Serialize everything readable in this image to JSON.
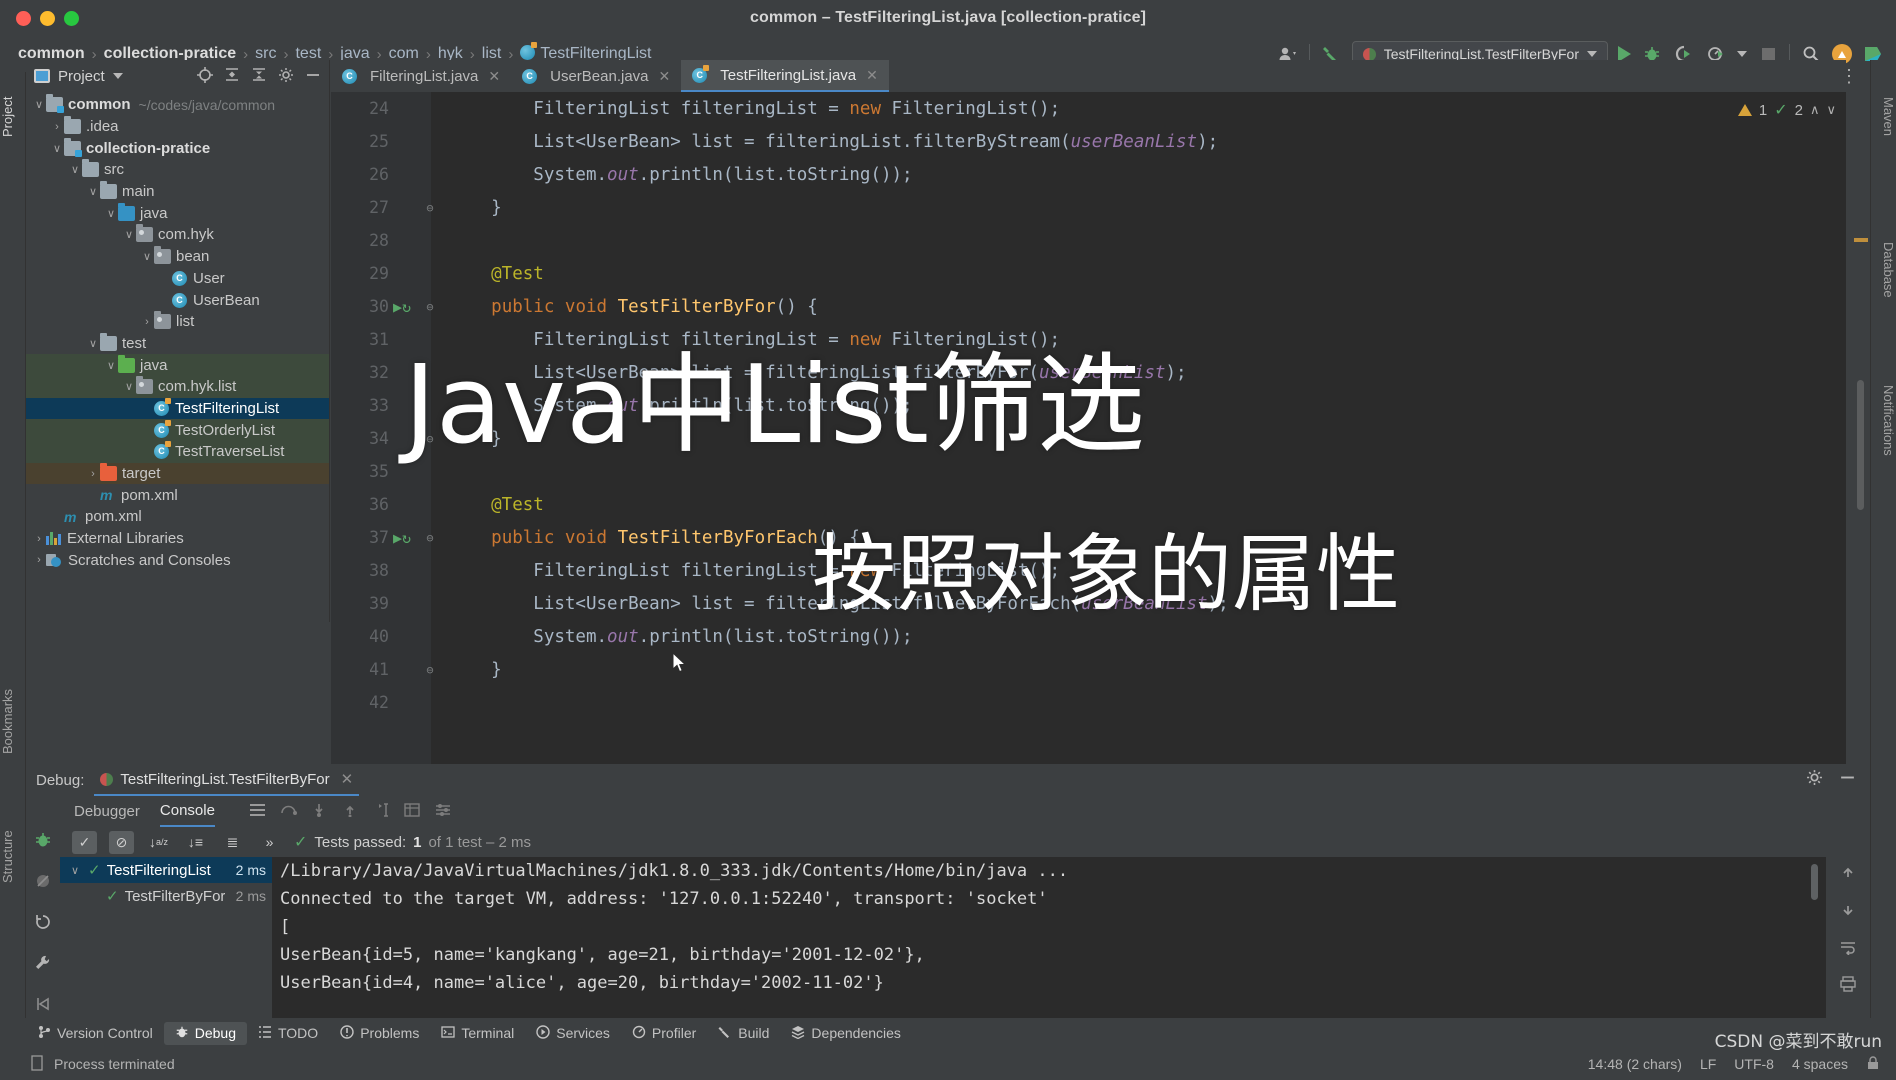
{
  "window": {
    "title": "common – TestFilteringList.java [collection-pratice]",
    "buttons": {
      "close": "close",
      "minimize": "minimize",
      "maximize": "maximize"
    }
  },
  "breadcrumb": {
    "items": [
      {
        "label": "common",
        "bold": true
      },
      {
        "label": "collection-pratice",
        "bold": true
      },
      {
        "label": "src",
        "bold": false
      },
      {
        "label": "test",
        "bold": false
      },
      {
        "label": "java",
        "bold": false
      },
      {
        "label": "com",
        "bold": false
      },
      {
        "label": "hyk",
        "bold": false
      },
      {
        "label": "list",
        "bold": false
      },
      {
        "label": "TestFilteringList",
        "bold": false,
        "icon": "java-test-class-icon"
      }
    ],
    "separator": "›"
  },
  "toolbar": {
    "run_config": "TestFilteringList.TestFilterByFor",
    "icons": [
      "user-icon",
      "hammer-build-icon",
      "run-icon",
      "debug-icon",
      "run-with-coverage-icon",
      "profiler-icon",
      "stop-icon",
      "search-icon",
      "update-icon",
      "ide-logo-icon"
    ]
  },
  "left_strip": {
    "tabs": [
      "Project",
      "Bookmarks",
      "Structure"
    ]
  },
  "right_strip": {
    "tabs": [
      "Maven",
      "Database",
      "Notifications"
    ]
  },
  "project_panel": {
    "title": "Project",
    "header_icons": [
      "locate-icon",
      "expand-all-icon",
      "collapse-all-icon",
      "settings-icon",
      "hide-icon"
    ],
    "tree": [
      {
        "depth": 0,
        "arrow": "v",
        "icon": "module-folder",
        "label": "common",
        "bold": true,
        "path": "~/codes/java/common",
        "state": ""
      },
      {
        "depth": 1,
        "arrow": ">",
        "icon": "folder",
        "label": ".idea",
        "bold": false,
        "path": "",
        "state": ""
      },
      {
        "depth": 1,
        "arrow": "v",
        "icon": "module-folder",
        "label": "collection-pratice",
        "bold": true,
        "path": "",
        "state": ""
      },
      {
        "depth": 2,
        "arrow": "v",
        "icon": "folder",
        "label": "src",
        "bold": false,
        "path": "",
        "state": ""
      },
      {
        "depth": 3,
        "arrow": "v",
        "icon": "folder",
        "label": "main",
        "bold": false,
        "path": "",
        "state": ""
      },
      {
        "depth": 4,
        "arrow": "v",
        "icon": "source-folder-blue",
        "label": "java",
        "bold": false,
        "path": "",
        "state": ""
      },
      {
        "depth": 5,
        "arrow": "v",
        "icon": "package",
        "label": "com.hyk",
        "bold": false,
        "path": "",
        "state": ""
      },
      {
        "depth": 6,
        "arrow": "v",
        "icon": "package",
        "label": "bean",
        "bold": false,
        "path": "",
        "state": ""
      },
      {
        "depth": 7,
        "arrow": "",
        "icon": "class",
        "label": "User",
        "bold": false,
        "path": "",
        "state": ""
      },
      {
        "depth": 7,
        "arrow": "",
        "icon": "class",
        "label": "UserBean",
        "bold": false,
        "path": "",
        "state": ""
      },
      {
        "depth": 6,
        "arrow": ">",
        "icon": "package",
        "label": "list",
        "bold": false,
        "path": "",
        "state": ""
      },
      {
        "depth": 3,
        "arrow": "v",
        "icon": "folder",
        "label": "test",
        "bold": false,
        "path": "",
        "state": ""
      },
      {
        "depth": 4,
        "arrow": "v",
        "icon": "test-source-folder-green",
        "label": "java",
        "bold": false,
        "path": "",
        "state": "green"
      },
      {
        "depth": 5,
        "arrow": "v",
        "icon": "package",
        "label": "com.hyk.list",
        "bold": false,
        "path": "",
        "state": "green"
      },
      {
        "depth": 6,
        "arrow": "",
        "icon": "test-class",
        "label": "TestFilteringList",
        "bold": false,
        "path": "",
        "state": "selected"
      },
      {
        "depth": 6,
        "arrow": "",
        "icon": "test-class",
        "label": "TestOrderlyList",
        "bold": false,
        "path": "",
        "state": "green"
      },
      {
        "depth": 6,
        "arrow": "",
        "icon": "test-class",
        "label": "TestTraverseList",
        "bold": false,
        "path": "",
        "state": "green"
      },
      {
        "depth": 3,
        "arrow": ">",
        "icon": "folder-excluded-red",
        "label": "target",
        "bold": false,
        "path": "",
        "state": "brown"
      },
      {
        "depth": 3,
        "arrow": "",
        "icon": "maven",
        "label": "pom.xml",
        "bold": false,
        "path": "",
        "state": ""
      },
      {
        "depth": 1,
        "arrow": "",
        "icon": "maven",
        "label": "pom.xml",
        "bold": false,
        "path": "",
        "state": ""
      },
      {
        "depth": 0,
        "arrow": ">",
        "icon": "external-libraries",
        "label": "External Libraries",
        "bold": false,
        "path": "",
        "state": ""
      },
      {
        "depth": 0,
        "arrow": ">",
        "icon": "scratches",
        "label": "Scratches and Consoles",
        "bold": false,
        "path": "",
        "state": ""
      }
    ]
  },
  "editor_tabs": [
    {
      "label": "FilteringList.java",
      "icon": "class-icon",
      "active": false
    },
    {
      "label": "UserBean.java",
      "icon": "class-icon",
      "active": false
    },
    {
      "label": "TestFilteringList.java",
      "icon": "test-class-icon",
      "active": true
    }
  ],
  "inspection": {
    "warnings": "1",
    "checks": "2"
  },
  "editor": {
    "lines": [
      {
        "num": "24",
        "run": false,
        "fold": "",
        "tokens": [
          {
            "t": "        FilteringList filteringList = ",
            "c": "def"
          },
          {
            "t": "new",
            "c": "kw"
          },
          {
            "t": " FilteringList()",
            "c": "def"
          },
          {
            "t": ";",
            "c": "def"
          }
        ]
      },
      {
        "num": "25",
        "run": false,
        "fold": "",
        "tokens": [
          {
            "t": "        List<UserBean> list = filteringList.filterByStream(",
            "c": "def"
          },
          {
            "t": "userBeanList",
            "c": "prm"
          },
          {
            "t": ");",
            "c": "def"
          }
        ]
      },
      {
        "num": "26",
        "run": false,
        "fold": "",
        "tokens": [
          {
            "t": "        System.",
            "c": "def"
          },
          {
            "t": "out",
            "c": "fld"
          },
          {
            "t": ".println(list.toString());",
            "c": "def"
          }
        ]
      },
      {
        "num": "27",
        "run": false,
        "fold": "end",
        "tokens": [
          {
            "t": "    }",
            "c": "def"
          }
        ]
      },
      {
        "num": "28",
        "run": false,
        "fold": "",
        "tokens": []
      },
      {
        "num": "29",
        "run": false,
        "fold": "",
        "tokens": [
          {
            "t": "    @Test",
            "c": "ann"
          }
        ]
      },
      {
        "num": "30",
        "run": true,
        "fold": "start",
        "tokens": [
          {
            "t": "    ",
            "c": "def"
          },
          {
            "t": "public void",
            "c": "kw"
          },
          {
            "t": " ",
            "c": "def"
          },
          {
            "t": "TestFilterByFor",
            "c": "mtd"
          },
          {
            "t": "() {",
            "c": "def"
          }
        ]
      },
      {
        "num": "31",
        "run": false,
        "fold": "",
        "tokens": [
          {
            "t": "        FilteringList filteringList = ",
            "c": "def"
          },
          {
            "t": "new",
            "c": "kw"
          },
          {
            "t": " FilteringList();",
            "c": "def"
          }
        ]
      },
      {
        "num": "32",
        "run": false,
        "fold": "",
        "tokens": [
          {
            "t": "        List<UserBean> list = filteringList.filterByFor(",
            "c": "def"
          },
          {
            "t": "userBeanList",
            "c": "prm"
          },
          {
            "t": ");",
            "c": "def"
          }
        ]
      },
      {
        "num": "33",
        "run": false,
        "fold": "",
        "tokens": [
          {
            "t": "        System.",
            "c": "def"
          },
          {
            "t": "out",
            "c": "fld"
          },
          {
            "t": ".println(list.toString());",
            "c": "def"
          }
        ]
      },
      {
        "num": "34",
        "run": false,
        "fold": "end",
        "tokens": [
          {
            "t": "    }",
            "c": "def"
          }
        ]
      },
      {
        "num": "35",
        "run": false,
        "fold": "",
        "tokens": []
      },
      {
        "num": "36",
        "run": false,
        "fold": "",
        "tokens": [
          {
            "t": "    @Test",
            "c": "ann"
          }
        ]
      },
      {
        "num": "37",
        "run": true,
        "fold": "start",
        "tokens": [
          {
            "t": "    ",
            "c": "def"
          },
          {
            "t": "public void",
            "c": "kw"
          },
          {
            "t": " ",
            "c": "def"
          },
          {
            "t": "TestFilterByForEach",
            "c": "mtd"
          },
          {
            "t": "() {",
            "c": "def"
          }
        ]
      },
      {
        "num": "38",
        "run": false,
        "fold": "",
        "tokens": [
          {
            "t": "        FilteringList filteringList = ",
            "c": "def"
          },
          {
            "t": "new",
            "c": "kw"
          },
          {
            "t": " FilteringList();",
            "c": "def"
          }
        ]
      },
      {
        "num": "39",
        "run": false,
        "fold": "",
        "tokens": [
          {
            "t": "        List<UserBean> list = filteringList.filterByForEach(",
            "c": "def"
          },
          {
            "t": "userBeanList",
            "c": "prm"
          },
          {
            "t": ");",
            "c": "def"
          }
        ]
      },
      {
        "num": "40",
        "run": false,
        "fold": "",
        "tokens": [
          {
            "t": "        System.",
            "c": "def"
          },
          {
            "t": "out",
            "c": "fld"
          },
          {
            "t": ".println(list.toString());",
            "c": "def"
          }
        ]
      },
      {
        "num": "41",
        "run": false,
        "fold": "end",
        "tokens": [
          {
            "t": "    }",
            "c": "def"
          }
        ]
      },
      {
        "num": "42",
        "run": false,
        "fold": "",
        "tokens": []
      }
    ]
  },
  "overlay": {
    "title_main": "Java中List筛选",
    "title_sub": "按照对象的属性"
  },
  "debug": {
    "label": "Debug:",
    "session_tab": "TestFilteringList.TestFilterByFor",
    "tabs": [
      "Debugger",
      "Console"
    ],
    "active_tab": "Console",
    "tool_icons": [
      "frames-icon",
      "step-over-icon",
      "step-into-icon",
      "step-out-icon",
      "run-to-cursor-icon",
      "table-icon",
      "settings-icon"
    ],
    "test_toolbar": {
      "buttons": [
        "show-passed-icon",
        "hide-ignored-icon",
        "sort-alpha-icon",
        "sort-duration-icon",
        "expand-icon",
        "more-icon"
      ],
      "status": {
        "prefix": "Tests passed:",
        "count": "1",
        "suffix": "of 1 test – 2 ms"
      }
    },
    "test_tree": [
      {
        "label": "TestFilteringList",
        "time": "2 ms",
        "selected": true,
        "arrow": "v",
        "depth": 0
      },
      {
        "label": "TestFilterByFor",
        "time": "2 ms",
        "selected": false,
        "arrow": "",
        "depth": 1
      }
    ],
    "console_lines": [
      {
        "text": "/Library/Java/JavaVirtualMachines/jdk1.8.0_333.jdk/Contents/Home/bin/java ...",
        "kind": "cmd"
      },
      {
        "text": "Connected to the target VM, address: '127.0.0.1:52240', transport: 'socket'",
        "kind": "out"
      },
      {
        "text": "[",
        "kind": "out"
      },
      {
        "text": "UserBean{id=5, name='kangkang', age=21, birthday='2001-12-02'},",
        "kind": "out"
      },
      {
        "text": "UserBean{id=4, name='alice', age=20, birthday='2002-11-02'}",
        "kind": "out"
      }
    ]
  },
  "statusbar": {
    "items": [
      {
        "label": "Version Control",
        "icon": "branch-icon",
        "active": false
      },
      {
        "label": "Debug",
        "icon": "debug-bug-icon",
        "active": true
      },
      {
        "label": "TODO",
        "icon": "todo-icon",
        "active": false
      },
      {
        "label": "Problems",
        "icon": "problems-icon",
        "active": false
      },
      {
        "label": "Terminal",
        "icon": "terminal-icon",
        "active": false
      },
      {
        "label": "Services",
        "icon": "services-icon",
        "active": false
      },
      {
        "label": "Profiler",
        "icon": "profiler-icon",
        "active": false
      },
      {
        "label": "Build",
        "icon": "build-hammer-icon",
        "active": false
      },
      {
        "label": "Dependencies",
        "icon": "dependencies-icon",
        "active": false
      }
    ],
    "message": "Process terminated",
    "caret": "14:48 (2 chars)",
    "line_sep": "LF",
    "encoding": "UTF-8",
    "indent": "4 spaces",
    "watermark": "CSDN @菜到不敢run"
  }
}
